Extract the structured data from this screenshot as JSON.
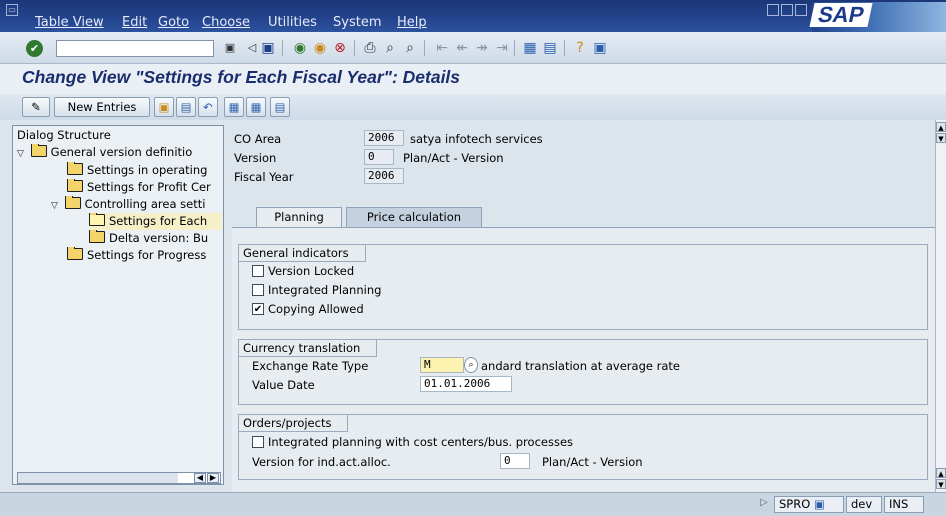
{
  "menu": [
    "Table View",
    "Edit",
    "Goto",
    "Choose",
    "Utilities",
    "System",
    "Help"
  ],
  "title": "Change View \"Settings for Each Fiscal Year\": Details",
  "app_toolbar": {
    "new_entries": "New Entries"
  },
  "tree": {
    "header": "Dialog Structure",
    "nodes": [
      "General version definitio",
      "Settings in operating",
      "Settings for Profit Cer",
      "Controlling area setti",
      "Settings for Each",
      "Delta version: Bu",
      "Settings for Progress"
    ]
  },
  "header_fields": {
    "co_area_label": "CO Area",
    "co_area_value": "2006",
    "co_area_text": "satya infotech services",
    "version_label": "Version",
    "version_value": "0",
    "version_text": "Plan/Act - Version",
    "fiscal_year_label": "Fiscal Year",
    "fiscal_year_value": "2006"
  },
  "tabs": [
    "Planning",
    "Price calculation"
  ],
  "general_indicators": {
    "title": "General indicators",
    "version_locked": "Version Locked",
    "integrated_planning": "Integrated Planning",
    "copying_allowed": "Copying Allowed"
  },
  "currency_translation": {
    "title": "Currency translation",
    "exchange_rate_label": "Exchange Rate Type",
    "exchange_rate_value": "M",
    "exchange_rate_text": "andard translation at average rate",
    "value_date_label": "Value Date",
    "value_date_value": "01.01.2006"
  },
  "orders_projects": {
    "title": "Orders/projects",
    "integrated_planning_cc": "Integrated planning with cost centers/bus. processes",
    "version_ind_label": "Version for ind.act.alloc.",
    "version_ind_value": "0",
    "version_ind_text": "Plan/Act - Version"
  },
  "status": {
    "transaction": "SPRO",
    "system": "dev",
    "mode": "INS"
  }
}
